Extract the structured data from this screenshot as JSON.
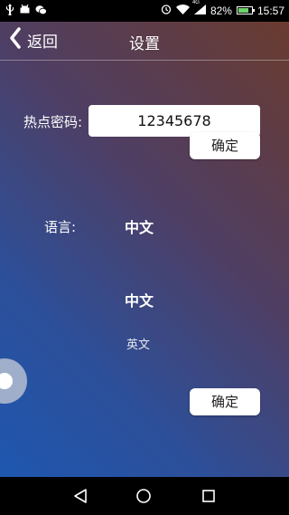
{
  "status_bar": {
    "network_label": "4G",
    "battery_text": "82%",
    "battery_level": 0.82,
    "time": "15:57",
    "left_icons": [
      "usb-icon",
      "android-icon",
      "wechat-icon"
    ],
    "right_icons": [
      "alarm-icon",
      "wifi-icon",
      "signal-icon",
      "battery-icon"
    ]
  },
  "header": {
    "back_label": "返回",
    "title": "设置"
  },
  "hotspot": {
    "label": "热点密码:",
    "value": "12345678",
    "confirm_label": "确定"
  },
  "language": {
    "label": "语言:",
    "current": "中文",
    "options": [
      "中文",
      "英文"
    ],
    "confirm_label": "确定"
  },
  "colors": {
    "gradient_top_right": "#6a3b2f",
    "gradient_bottom_left": "#1e57b0",
    "battery_green": "#6dd36b"
  },
  "nav_icons": [
    "nav-back-icon",
    "nav-home-icon",
    "nav-recent-icon"
  ]
}
